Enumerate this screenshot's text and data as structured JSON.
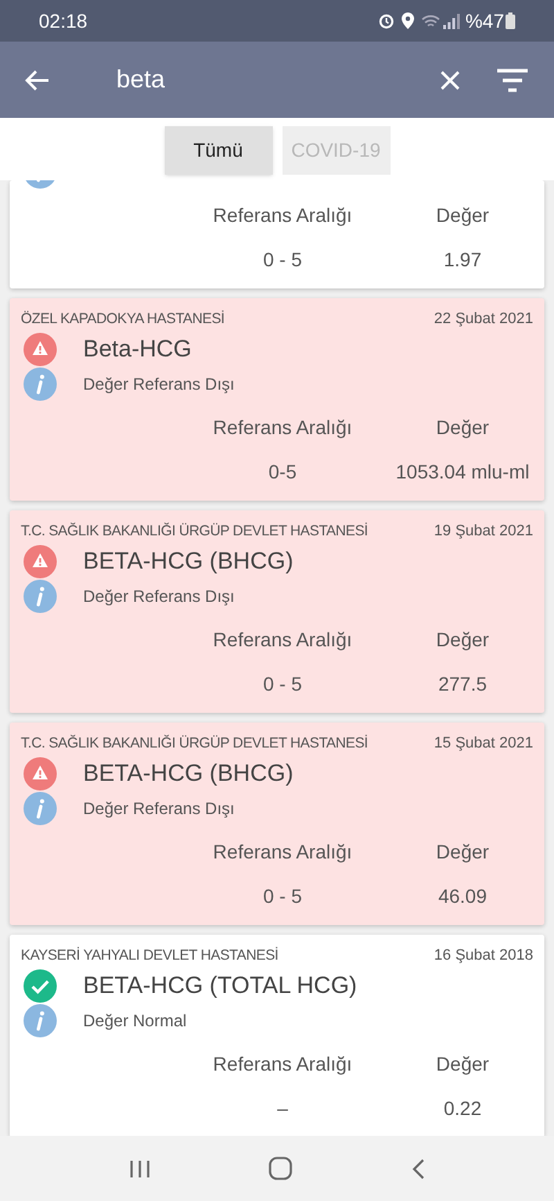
{
  "status_bar": {
    "time": "02:18",
    "battery": "%47"
  },
  "search": {
    "value": "beta"
  },
  "tabs": [
    {
      "label": "Tümü",
      "selected": true
    },
    {
      "label": "COVID-19",
      "selected": false
    }
  ],
  "results": [
    {
      "kind": "normal",
      "partial": true,
      "range_label": "Referans Aralığı",
      "value_label": "Değer",
      "range": "0 - 5",
      "value": "1.97"
    },
    {
      "kind": "abnormal",
      "partial": false,
      "hospital": "ÖZEL KAPADOKYA HASTANESİ",
      "date": "22 Şubat 2021",
      "test": "Beta-HCG",
      "status_text": "Değer Referans Dışı",
      "range_label": "Referans Aralığı",
      "value_label": "Değer",
      "range": "0-5",
      "value": "1053.04 mlu-ml"
    },
    {
      "kind": "abnormal",
      "partial": false,
      "hospital": "T.C. SAĞLIK BAKANLIĞI ÜRGÜP DEVLET HASTANESİ",
      "date": "19 Şubat 2021",
      "test": "BETA-HCG (BHCG)",
      "status_text": "Değer Referans Dışı",
      "range_label": "Referans Aralığı",
      "value_label": "Değer",
      "range": "0 - 5",
      "value": "277.5"
    },
    {
      "kind": "abnormal",
      "partial": false,
      "hospital": "T.C. SAĞLIK BAKANLIĞI ÜRGÜP DEVLET HASTANESİ",
      "date": "15 Şubat 2021",
      "test": "BETA-HCG (BHCG)",
      "status_text": "Değer Referans Dışı",
      "range_label": "Referans Aralığı",
      "value_label": "Değer",
      "range": "0 - 5",
      "value": "46.09"
    },
    {
      "kind": "normal",
      "partial": false,
      "hospital": "KAYSERİ YAHYALI DEVLET HASTANESİ",
      "date": "16 Şubat 2018",
      "test": "BETA-HCG (TOTAL HCG)",
      "status_text": "Değer Normal",
      "range_label": "Referans Aralığı",
      "value_label": "Değer",
      "range": "–",
      "value": "0.22"
    }
  ]
}
